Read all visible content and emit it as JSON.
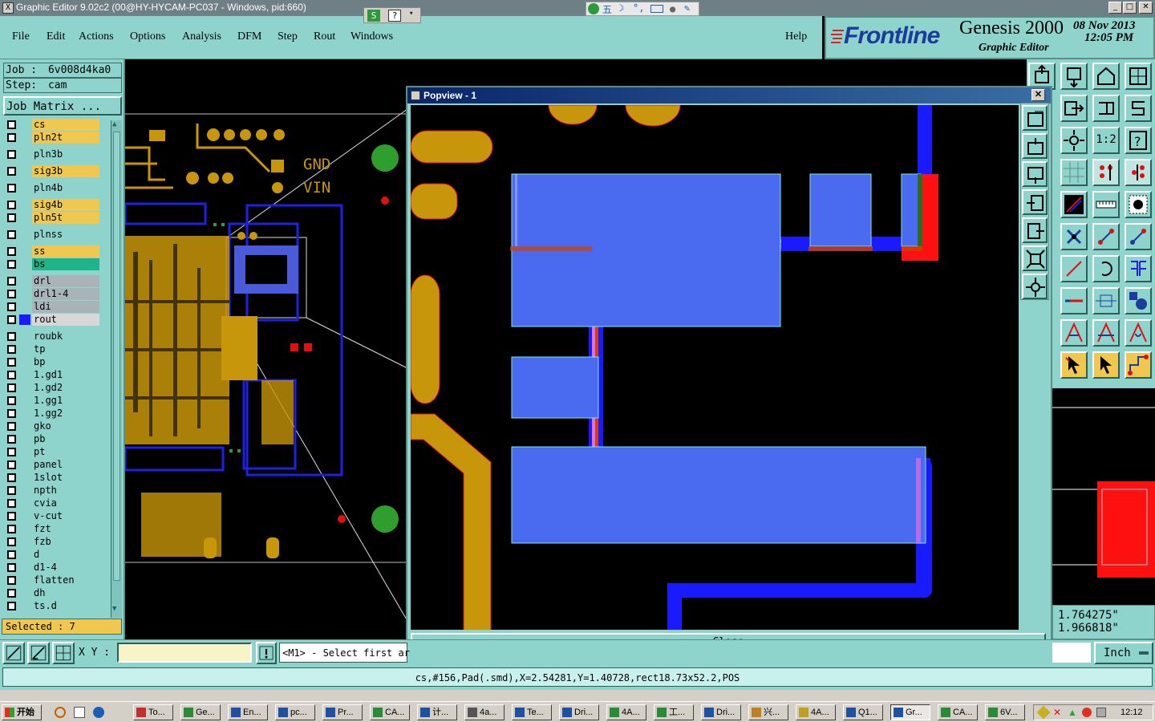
{
  "window": {
    "title": "Graphic Editor 9.02c2 (00@HY-HYCAM-PC037 - Windows, pid:660)",
    "min": "_",
    "max": "□",
    "close": "✕"
  },
  "menu": [
    "File",
    "Edit",
    "Actions",
    "Options",
    "Analysis",
    "DFM",
    "Step",
    "Rout",
    "Windows"
  ],
  "help": "Help",
  "brand": {
    "logo": "Frontline",
    "product": "Genesis 2000",
    "subtitle": "Graphic Editor",
    "date": "08 Nov 2013",
    "time": "12:05 PM"
  },
  "job": {
    "job_label": "Job :",
    "job_value": "6v008d4ka0",
    "step_label": "Step:",
    "step_value": "cam",
    "matrix_btn": "Job Matrix ..."
  },
  "layers": [
    {
      "name": "cs",
      "color": "#f0c850"
    },
    {
      "name": "pln2t",
      "color": "#f0c850"
    },
    {
      "name": "pln3b",
      "color": "#8fd4cc"
    },
    {
      "name": "sig3b",
      "color": "#f0c850"
    },
    {
      "name": "pln4b",
      "color": "#8fd4cc"
    },
    {
      "name": "sig4b",
      "color": "#f0c850"
    },
    {
      "name": "pln5t",
      "color": "#f0c850"
    },
    {
      "name": "plnss",
      "color": "#8fd4cc"
    },
    {
      "name": "ss",
      "color": "#f0c850"
    },
    {
      "name": "bs",
      "color": "#1eb48c"
    },
    {
      "name": "drl",
      "color": "#a8b4b8"
    },
    {
      "name": "drl1-4",
      "color": "#a8b4b8"
    },
    {
      "name": "ldi",
      "color": "#a8b4b8"
    },
    {
      "name": "rout",
      "color": "#d8d8d8"
    },
    {
      "name": "roubk",
      "color": "#8fd4cc"
    },
    {
      "name": "tp",
      "color": "#8fd4cc"
    },
    {
      "name": "bp",
      "color": "#8fd4cc"
    },
    {
      "name": "1.gd1",
      "color": "#8fd4cc"
    },
    {
      "name": "1.gd2",
      "color": "#8fd4cc"
    },
    {
      "name": "1.gg1",
      "color": "#8fd4cc"
    },
    {
      "name": "1.gg2",
      "color": "#8fd4cc"
    },
    {
      "name": "gko",
      "color": "#8fd4cc"
    },
    {
      "name": "pb",
      "color": "#8fd4cc"
    },
    {
      "name": "pt",
      "color": "#8fd4cc"
    },
    {
      "name": "panel",
      "color": "#8fd4cc"
    },
    {
      "name": "1slot",
      "color": "#8fd4cc"
    },
    {
      "name": "npth",
      "color": "#8fd4cc"
    },
    {
      "name": "cvia",
      "color": "#8fd4cc"
    },
    {
      "name": "v-cut",
      "color": "#8fd4cc"
    },
    {
      "name": "fzt",
      "color": "#8fd4cc"
    },
    {
      "name": "fzb",
      "color": "#8fd4cc"
    },
    {
      "name": "d",
      "color": "#8fd4cc"
    },
    {
      "name": "d1-4",
      "color": "#8fd4cc"
    },
    {
      "name": "flatten",
      "color": "#8fd4cc"
    },
    {
      "name": "dh",
      "color": "#8fd4cc"
    },
    {
      "name": "ts.d",
      "color": "#8fd4cc"
    }
  ],
  "selected": "Selected : 7",
  "board_labels": {
    "gnd": "GND",
    "vin": "VIN"
  },
  "popview": {
    "title": "Popview - 1",
    "close": "Close"
  },
  "toolbox_icons": {
    "one_to_two": "1:2"
  },
  "coords": {
    "x": "1.764275\"",
    "y": "1.966818\""
  },
  "units": "Inch",
  "cmd": {
    "xy_label": "X Y :",
    "xy_value": "",
    "prompt": "<M1> - Select first ar"
  },
  "status": "cs,#156,Pad(.smd),X=2.54281,Y=1.40728,rect18.73x52.2,POS",
  "taskbar": {
    "start": "开始",
    "clock": "12:12",
    "tasks": [
      "To...",
      "Ge...",
      "En...",
      "pc...",
      "Pr...",
      "CA...",
      "计...",
      "4a...",
      "Te...",
      "Dri...",
      "4A...",
      "工...",
      "Dri...",
      "兴...",
      "4A...",
      "Q1...",
      "Gr...",
      "CA...",
      "6V..."
    ]
  }
}
